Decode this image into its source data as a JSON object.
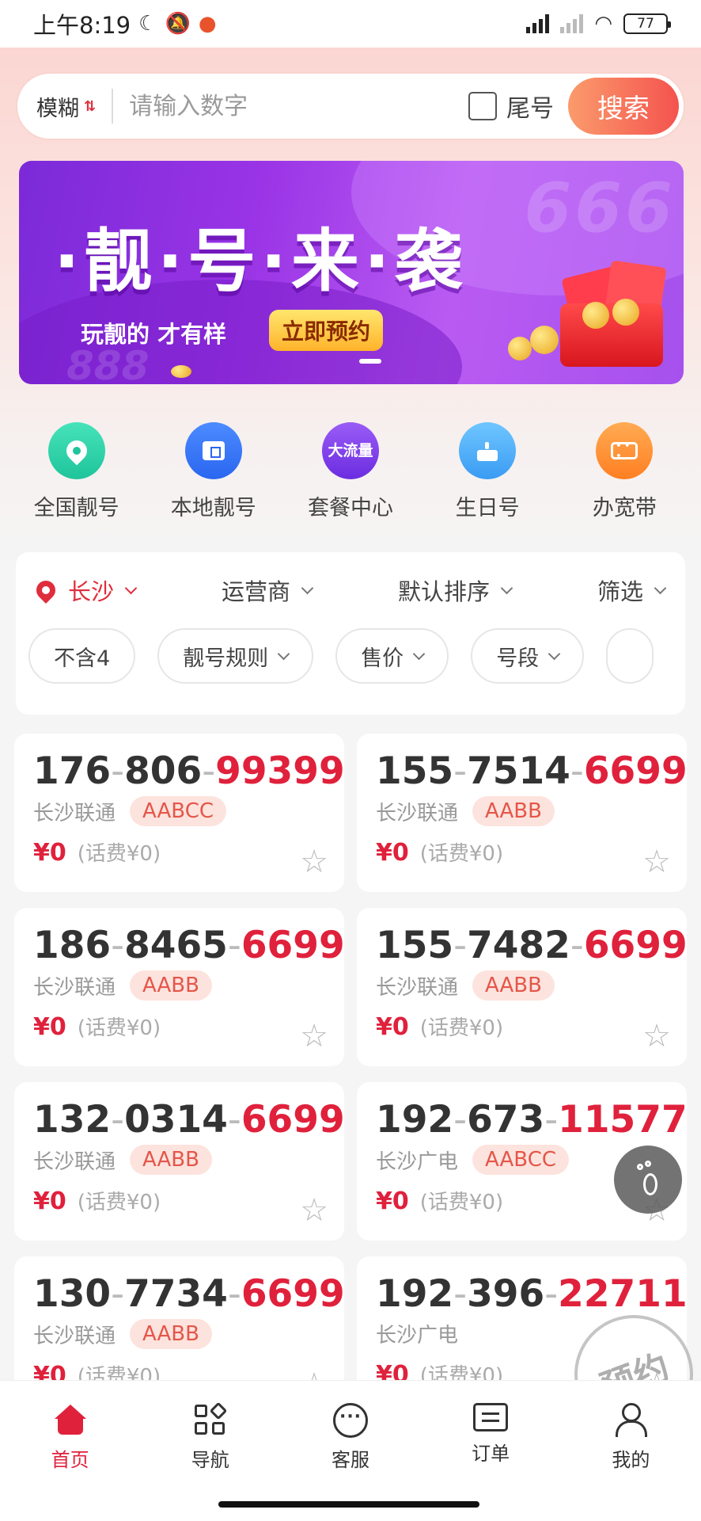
{
  "status_bar": {
    "time": "上午8:19",
    "battery": "77"
  },
  "search": {
    "mode_label": "模糊",
    "placeholder": "请输入数字",
    "tail_label": "尾号",
    "button_label": "搜索"
  },
  "banner": {
    "title": "·靓·号·来·袭",
    "slogan": "玩靓的 才有样",
    "cta": "立即预约"
  },
  "categories": [
    {
      "label": "全国靓号"
    },
    {
      "label": "本地靓号"
    },
    {
      "label": "套餐中心",
      "icon_text": "大流量"
    },
    {
      "label": "生日号"
    },
    {
      "label": "办宽带"
    }
  ],
  "filters": {
    "row1": [
      "长沙",
      "运营商",
      "默认排序",
      "筛选"
    ],
    "chips": [
      "不含4",
      "靓号规则",
      "售价",
      "号段"
    ]
  },
  "numbers": [
    {
      "p1": "176",
      "p2": "806",
      "p3": "99399",
      "carrier": "长沙联通",
      "tag": "AABCC",
      "price": "¥0",
      "fee": "(话费¥0)"
    },
    {
      "p1": "155",
      "p2": "7514",
      "p3": "6699",
      "carrier": "长沙联通",
      "tag": "AABB",
      "price": "¥0",
      "fee": "(话费¥0)"
    },
    {
      "p1": "186",
      "p2": "8465",
      "p3": "6699",
      "carrier": "长沙联通",
      "tag": "AABB",
      "price": "¥0",
      "fee": "(话费¥0)"
    },
    {
      "p1": "155",
      "p2": "7482",
      "p3": "6699",
      "carrier": "长沙联通",
      "tag": "AABB",
      "price": "¥0",
      "fee": "(话费¥0)"
    },
    {
      "p1": "132",
      "p2": "0314",
      "p3": "6699",
      "carrier": "长沙联通",
      "tag": "AABB",
      "price": "¥0",
      "fee": "(话费¥0)"
    },
    {
      "p1": "192",
      "p2": "673",
      "p3": "11577",
      "carrier": "长沙广电",
      "tag": "AABCC",
      "price": "¥0",
      "fee": "(话费¥0)"
    },
    {
      "p1": "130",
      "p2": "7734",
      "p3": "6699",
      "carrier": "长沙联通",
      "tag": "AABB",
      "price": "¥0",
      "fee": "(话费¥0)"
    },
    {
      "p1": "192",
      "p2": "396",
      "p3": "22711",
      "carrier": "长沙广电",
      "tag": "",
      "price": "¥0",
      "fee": "(话费¥0)"
    }
  ],
  "stamp_text": "预约",
  "tabbar": [
    {
      "label": "首页",
      "icon": "home-icon"
    },
    {
      "label": "导航",
      "icon": "grid-icon"
    },
    {
      "label": "客服",
      "icon": "chat-icon"
    },
    {
      "label": "订单",
      "icon": "order-icon"
    },
    {
      "label": "我的",
      "icon": "profile-icon"
    }
  ],
  "colors": {
    "accent": "#e0213c",
    "search_gradient_start": "#fb9b6c",
    "search_gradient_end": "#f4534e",
    "tag_bg": "#fde3dd"
  }
}
